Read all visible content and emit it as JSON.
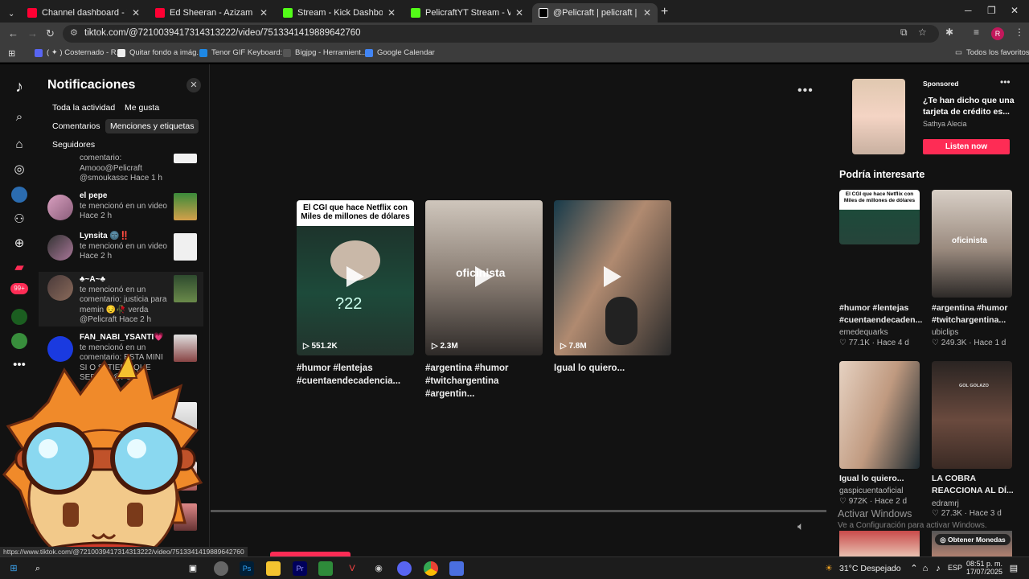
{
  "browser": {
    "tabs": [
      {
        "label": "Channel dashboard - YouTube",
        "color": "#ff0033"
      },
      {
        "label": "Ed Sheeran - Azizam (Pink Hea",
        "color": "#ff0033"
      },
      {
        "label": "Stream - Kick Dashboard",
        "color": "#53fc18"
      },
      {
        "label": "PelicraftYT Stream - Watch Live",
        "color": "#53fc18"
      },
      {
        "label": "@Pelicraft | pelicraft | TikTok",
        "color": "#ffffff"
      }
    ],
    "url": "tiktok.com/@7210039417314313222/video/7513341419889642760",
    "profile_initial": "R",
    "bookmarks": [
      {
        "label": "( ✦ ) Costernado - R...",
        "color": "#5865f2"
      },
      {
        "label": "Quitar fondo a imág...",
        "color": "#eeeeee"
      },
      {
        "label": "Tenor GIF Keyboard:...",
        "color": "#1e88e5"
      },
      {
        "label": "Bigjpg - Herramient...",
        "color": "#555555"
      },
      {
        "label": "Google Calendar",
        "color": "#4285f4"
      }
    ],
    "all_bookmarks": "Todos los favoritos",
    "status_url": "https://www.tiktok.com/@7210039417314313222/video/7513341419889642760"
  },
  "notifications": {
    "title": "Notificaciones",
    "chips": [
      "Toda la actividad",
      "Me gusta",
      "Comentarios",
      "Menciones y etiquetas",
      "Seguidores"
    ],
    "items": [
      {
        "text_before": "comentario: Amooo@Pelicraft @smoukassc",
        "time": "Hace 1 h"
      },
      {
        "user": "el pepe",
        "text": "te mencionó en un video",
        "time": "Hace 2 h"
      },
      {
        "user": "Lynsita 🌚‼️",
        "text": "te mencionó en un video",
        "time": "Hace 2 h"
      },
      {
        "user": "♣~A~♣",
        "text": "te mencionó en un comentario: justicia para memin 😔🥀 verda @Pelicraft",
        "time": "Hace 2 h"
      },
      {
        "user": "FAN_NABI_YSANTI💗",
        "text": "te mencionó en un comentario: ESTA MINI SI O SI TIENE QUE SER ❤️! @Pelic",
        "time": ""
      }
    ]
  },
  "main": {
    "more_label": "•••",
    "videos": [
      {
        "caption": "El CGI que hace Netflix con Miles de millones de dólares",
        "overlay": "?22",
        "views": "551.2K",
        "title": "#humor #lentejas #cuentaendecadencia..."
      },
      {
        "caption": "",
        "overlay": "oficinista",
        "views": "2.3M",
        "title": "#argentina #humor #twitchargentina #argentin..."
      },
      {
        "caption": "",
        "overlay": "",
        "views": "7.8M",
        "title": "Igual lo quiero..."
      }
    ]
  },
  "right": {
    "sponsored_label": "Sponsored",
    "ad_text": "¿Te han dicho que una tarjeta de crédito es...",
    "ad_author": "Sathya Alecia",
    "listen_label": "Listen now",
    "section_title": "Podría interesarte",
    "recommendations": [
      {
        "overlay_text": "El CGI que hace Netflix con Miles de millones de dólares",
        "title": "#humor #lentejas #cuentaendecaden...",
        "author": "emedequarks",
        "likes": "77.1K",
        "time": "Hace 4 d"
      },
      {
        "overlay_text": "oficinista",
        "title": "#argentina #humor #twitchargentina...",
        "author": "ubiclips",
        "likes": "249.3K",
        "time": "Hace 1 d"
      },
      {
        "overlay_text": "",
        "title": "Igual lo quiero...",
        "author": "gaspicuentaoficial",
        "likes": "972K",
        "time": "Hace 2 d"
      },
      {
        "overlay_text": "GOL GOLAZO",
        "title": "LA COBRA REACCIONA AL DÍ...",
        "author": "edramrj",
        "likes": "27.3K",
        "time": "Hace 3 d"
      }
    ],
    "coins_label": "Obtener Monedas"
  },
  "windows": {
    "activate_title": "Activar Windows",
    "activate_sub": "Ve a Configuración para activar Windows.",
    "weather": "31°C  Despejado",
    "lang": "ESP",
    "time": "08:51 p. m.",
    "date": "17/07/2025"
  }
}
